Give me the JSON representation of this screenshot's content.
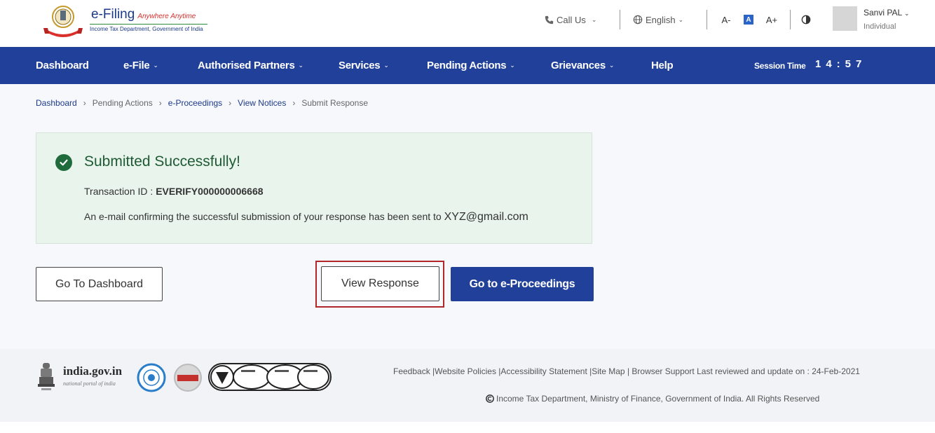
{
  "header": {
    "brand_name": "e-Filing",
    "brand_tagline": "Anywhere Anytime",
    "brand_sub": "Income Tax Department, Government of India",
    "call_us": "Call Us",
    "language": "English",
    "font_decrease": "A-",
    "font_default": "A",
    "font_increase": "A+",
    "user_name": "Sanvi PAL",
    "user_role": "Individual"
  },
  "nav": {
    "items": [
      {
        "label": "Dashboard",
        "caret": false
      },
      {
        "label": "e-File",
        "caret": true
      },
      {
        "label": "Authorised Partners",
        "caret": true
      },
      {
        "label": "Services",
        "caret": true
      },
      {
        "label": "Pending Actions",
        "caret": true
      },
      {
        "label": "Grievances",
        "caret": true
      },
      {
        "label": "Help",
        "caret": false
      }
    ],
    "session_label": "Session Time",
    "session_time": "14:57"
  },
  "breadcrumb": [
    "Dashboard",
    "Pending Actions",
    "e-Proceedings",
    "View Notices",
    "Submit Response"
  ],
  "success": {
    "title": "Submitted Successfully!",
    "tx_label": "Transaction ID : ",
    "tx_id": "EVERIFY000000006668",
    "email_text": "An e-mail confirming the successful submission of your response has been sent to ",
    "email_addr": "XYZ@gmail.com"
  },
  "buttons": {
    "dashboard": "Go To Dashboard",
    "view_response": "View Response",
    "e_proceedings": "Go to e-Proceedings"
  },
  "footer": {
    "gov_name": "india.gov.in",
    "gov_sub": "national portal of india",
    "links": "Feedback |Website Policies |Accessibility Statement |Site Map | Browser Support   Last reviewed and update on : 24-Feb-2021",
    "copyright": "Income Tax Department, Ministry of Finance, Government of India. All Rights Reserved"
  },
  "colors": {
    "nav_bg": "#21409a",
    "success_bg": "#e9f4ec",
    "success_check": "#1f6b3c",
    "highlight": "#b3262a"
  }
}
